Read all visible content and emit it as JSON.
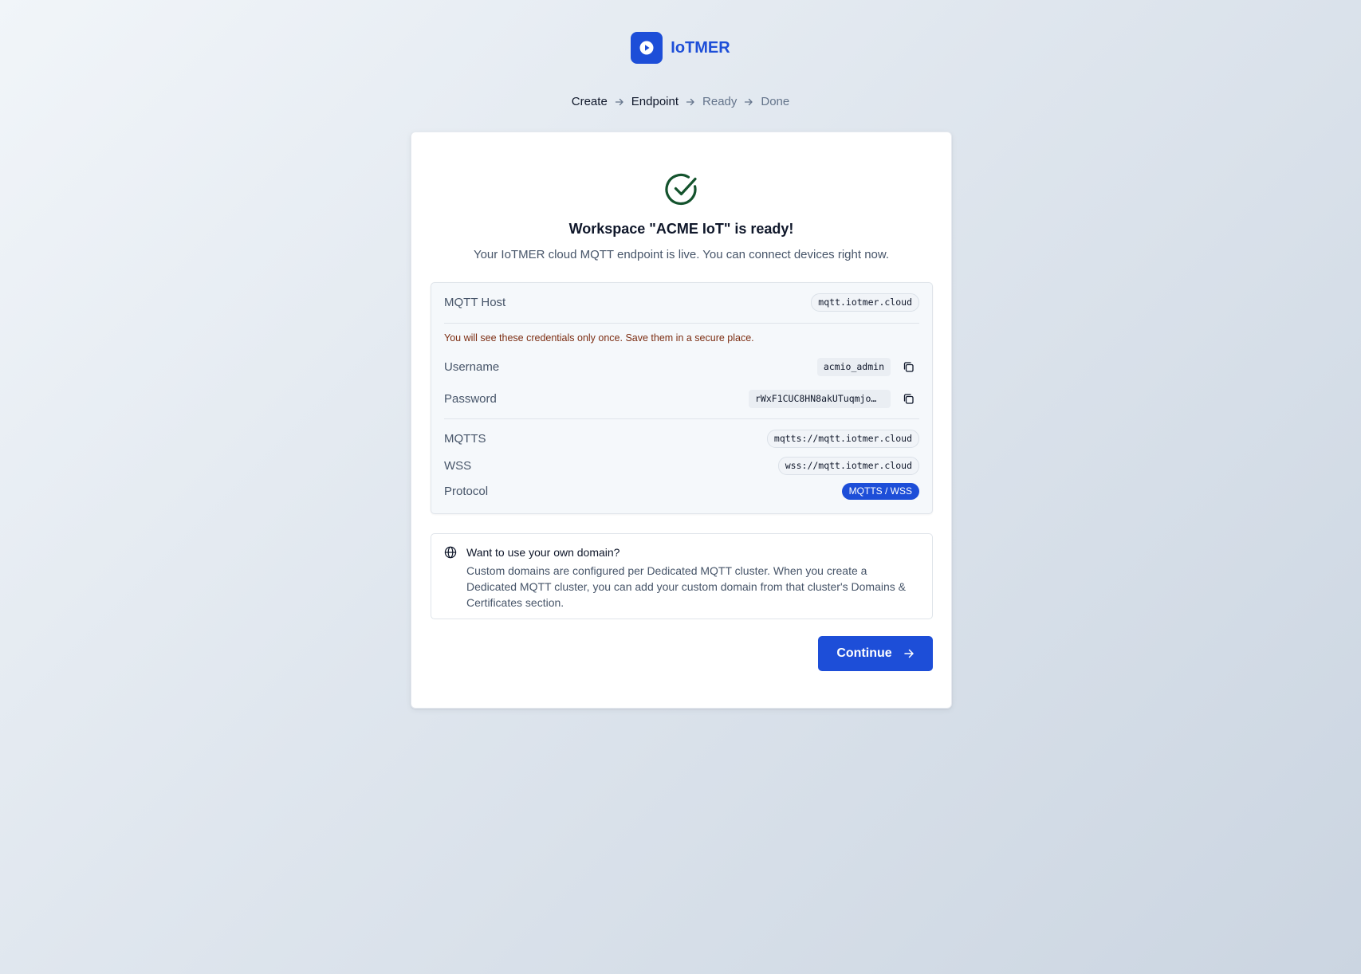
{
  "brand": {
    "name": "IoTMER",
    "logo_icon": "play-circle-icon",
    "color": "#1d4ed8"
  },
  "steps": [
    {
      "label": "Create",
      "state": "done"
    },
    {
      "label": "Endpoint",
      "state": "current"
    },
    {
      "label": "Ready",
      "state": "upcoming"
    },
    {
      "label": "Done",
      "state": "upcoming"
    }
  ],
  "card": {
    "status_icon": "check-circle-icon",
    "title": "Workspace \"ACME IoT\" is ready!",
    "subtitle": "Your IoTMER cloud MQTT endpoint is live. You can connect devices right now."
  },
  "endpoint": {
    "host_label": "MQTT Host",
    "host_value": "mqtt.iotmer.cloud",
    "warning": "You will see these credentials only once. Save them in a secure place.",
    "username_label": "Username",
    "username_value": "acmio_admin",
    "password_label": "Password",
    "password_value": "rWxF1CUC8HN8akUTuqmjo…",
    "mqtts_label": "MQTTS",
    "mqtts_value": "mqtts://mqtt.iotmer.cloud",
    "wss_label": "WSS",
    "wss_value": "wss://mqtt.iotmer.cloud",
    "protocol_label": "Protocol",
    "protocol_value": "MQTTS / WSS"
  },
  "domain": {
    "icon": "globe-icon",
    "title": "Want to use your own domain?",
    "text": "Custom domains are configured per Dedicated MQTT cluster. When you create a Dedicated MQTT cluster, you can add your custom domain from that cluster's Domains & Certificates section."
  },
  "actions": {
    "continue_label": "Continue",
    "continue_icon": "arrow-right-icon"
  },
  "colors": {
    "accent": "#1d4ed8",
    "success": "#14532d",
    "warning_text": "#7c2d12"
  }
}
